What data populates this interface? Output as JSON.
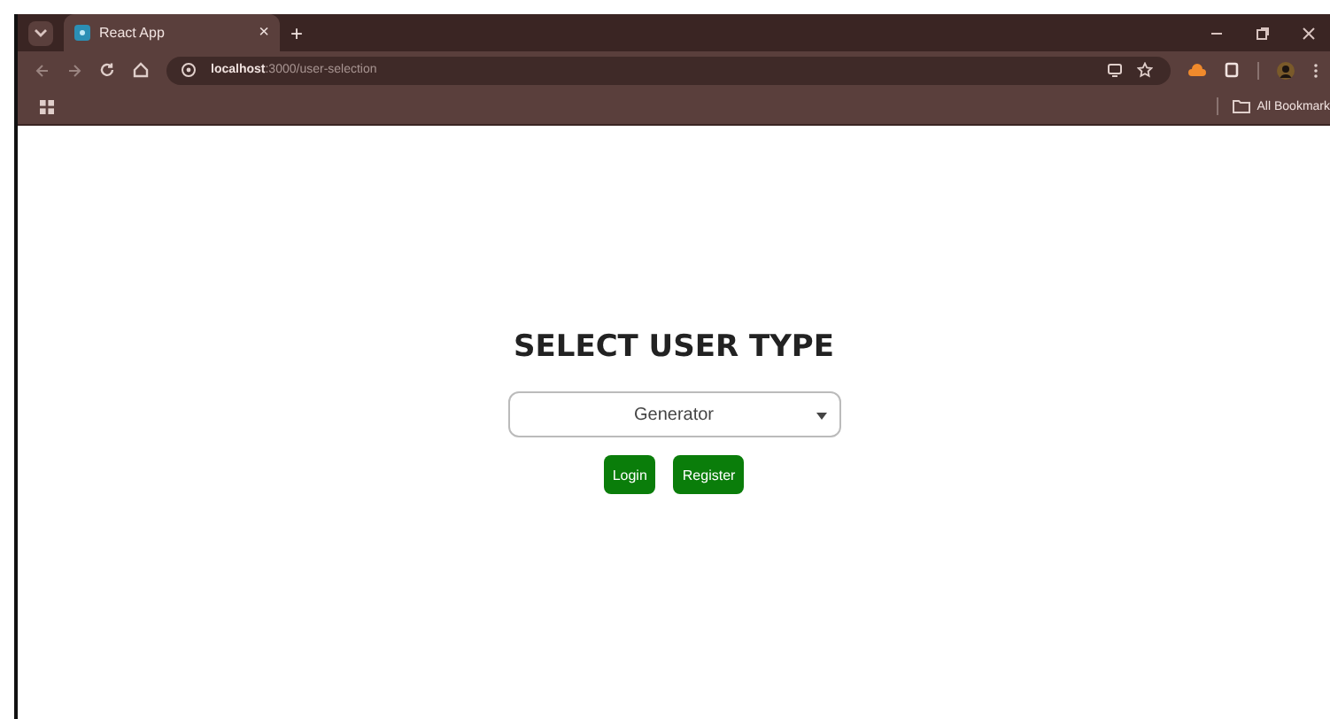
{
  "browser": {
    "tab_title": "React App",
    "tab_close": "×",
    "new_tab": "+",
    "url_host": "localhost",
    "url_path": ":3000/user-selection",
    "bookmarks_label": "All Bookmark"
  },
  "page": {
    "heading": "SELECT USER TYPE",
    "user_type": {
      "value": "Generator"
    },
    "buttons": [
      "Login",
      "Register"
    ]
  }
}
